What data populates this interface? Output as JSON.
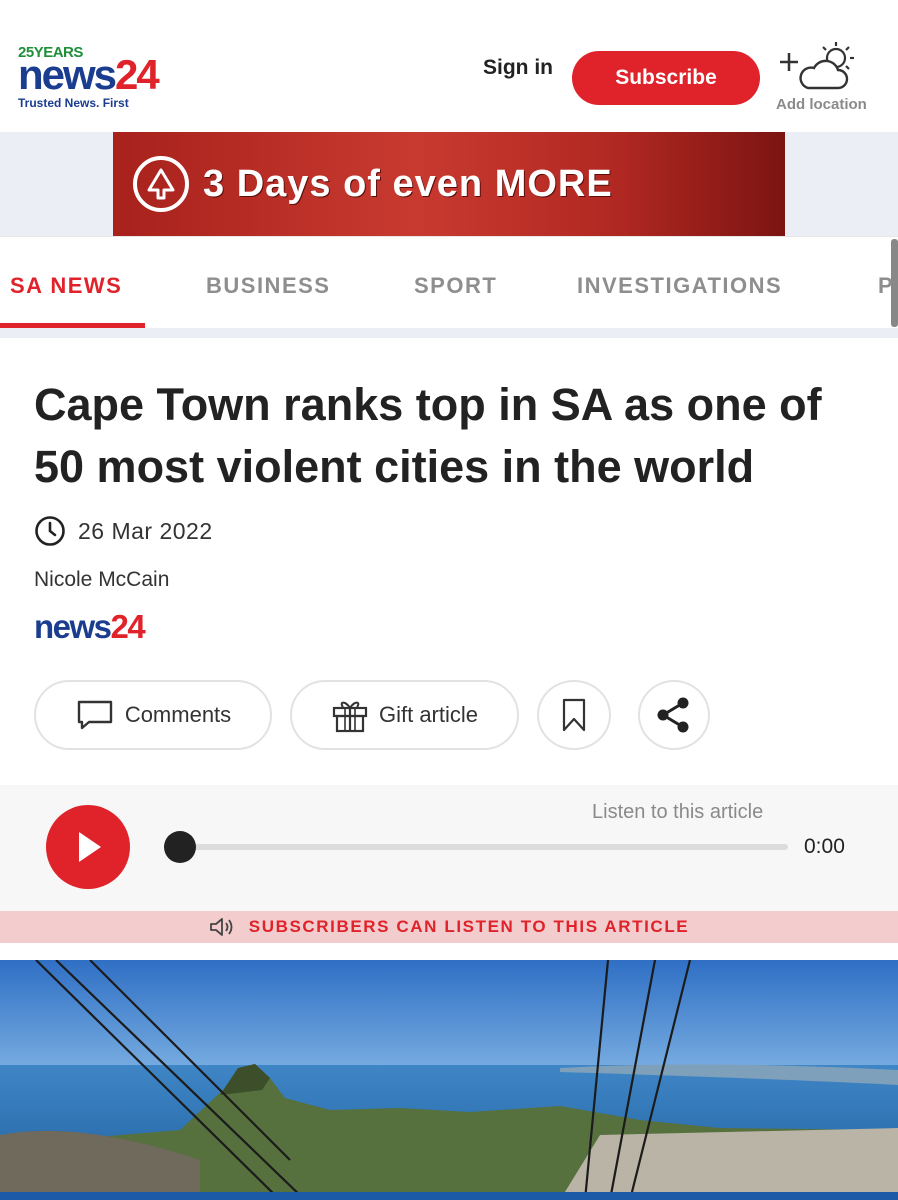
{
  "header": {
    "logo": {
      "years": "25YEARS",
      "brand_news": "news",
      "brand_num": "24",
      "tagline": "Trusted News. First"
    },
    "signin_label": "Sign in",
    "subscribe_label": "Subscribe",
    "add_location_label": "Add location"
  },
  "ad": {
    "text": "3 Days of even MORE"
  },
  "nav": {
    "items": [
      {
        "label": "SA NEWS",
        "active": true
      },
      {
        "label": "BUSINESS",
        "active": false
      },
      {
        "label": "SPORT",
        "active": false
      },
      {
        "label": "INVESTIGATIONS",
        "active": false
      },
      {
        "label": "P",
        "active": false
      }
    ]
  },
  "article": {
    "headline": "Cape Town ranks top in SA as one of 50 most violent cities in the world",
    "date": "26 Mar 2022",
    "author": "Nicole McCain",
    "source_news": "news",
    "source_num": "24"
  },
  "actions": {
    "comments_label": "Comments",
    "gift_label": "Gift article"
  },
  "audio": {
    "listen_label": "Listen to this article",
    "time": "0:00",
    "progress": 0,
    "subscriber_notice": "SUBSCRIBERS CAN LISTEN TO THIS ARTICLE"
  },
  "colors": {
    "brand_red": "#e0222a",
    "brand_blue": "#1a3d8f",
    "nav_inactive": "#8e8e8e"
  },
  "icons": [
    "cloud-sun-icon",
    "clock-icon",
    "comment-icon",
    "gift-icon",
    "bookmark-icon",
    "share-icon",
    "play-icon",
    "speaker-icon"
  ]
}
